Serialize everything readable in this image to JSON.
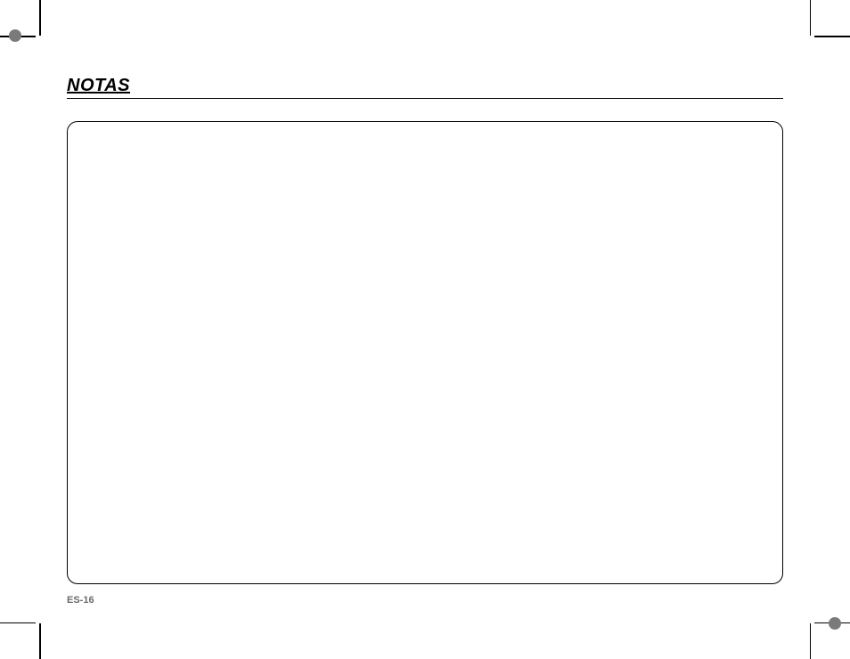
{
  "heading": "NOTAS",
  "page_number": "ES-16"
}
